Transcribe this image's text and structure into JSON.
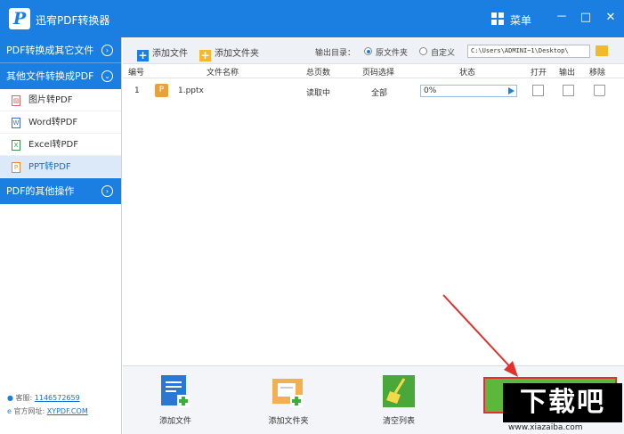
{
  "window": {
    "logo_letter": "P",
    "title": "迅宥PDF转换器",
    "menu_label": "菜单",
    "minimize": "－",
    "maximize": "□",
    "close": "✕"
  },
  "sidebar": {
    "sections": [
      {
        "label": "PDF转换成其它文件",
        "toggle": "›"
      },
      {
        "label": "其他文件转换成PDF",
        "toggle": "⌄"
      },
      {
        "label": "PDF的其他操作",
        "toggle": "›"
      }
    ],
    "items": [
      {
        "label": "图片转PDF",
        "icon": "image-file-icon",
        "glyph": "▨"
      },
      {
        "label": "Word转PDF",
        "icon": "word-file-icon",
        "glyph": "W"
      },
      {
        "label": "Excel转PDF",
        "icon": "excel-file-icon",
        "glyph": "X"
      },
      {
        "label": "PPT转PDF",
        "icon": "ppt-file-icon",
        "glyph": "P"
      }
    ],
    "support": {
      "label": "客服:",
      "value": "1146572659"
    },
    "website": {
      "label": "官方网址:",
      "value": "XYPDF.COM"
    }
  },
  "toolbar": {
    "add_file": "添加文件",
    "add_folder": "添加文件夹",
    "output_dir_label": "输出目录：",
    "option_original": "原文件夹",
    "option_custom": "自定义",
    "output_path": "C:\\Users\\ADMINI~1\\Desktop\\"
  },
  "table": {
    "headers": [
      "编号",
      "文件名称",
      "总页数",
      "页码选择",
      "状态",
      "打开",
      "输出",
      "移除"
    ],
    "rows": [
      {
        "index": "1",
        "file_icon": "P",
        "filename": "1.pptx",
        "pages": "读取中",
        "page_select": "全部",
        "progress": "0%"
      }
    ]
  },
  "actions": {
    "add_file": "添加文件",
    "add_folder": "添加文件夹",
    "clear_list": "清空列表"
  },
  "watermark": {
    "brand": "下载吧",
    "url": "www.xiazaiba.com"
  },
  "colors": {
    "primary": "#1a7fe0",
    "start_green": "#5cb83a",
    "annotation_red": "#e03030"
  }
}
